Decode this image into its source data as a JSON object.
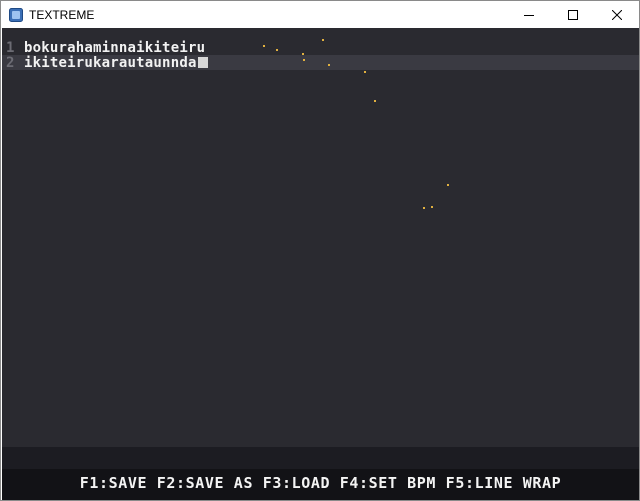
{
  "window": {
    "title": "TEXTREME",
    "icons": {
      "app": "app-icon",
      "minimize": "minimize-icon",
      "maximize": "maximize-icon",
      "close": "close-icon"
    }
  },
  "editor": {
    "lines": [
      {
        "number": "1",
        "text": "bokurahaminnaikiteiru"
      },
      {
        "number": "2",
        "text": "ikiteirukarautaunnda"
      }
    ],
    "current_line": 2,
    "particle_color": "#e0b040"
  },
  "footer": {
    "shortcuts": "F1:SAVE F2:SAVE AS F3:LOAD F4:SET BPM F5:LINE WRAP"
  },
  "colors": {
    "editor_bg": "#2a2a30",
    "current_line_bg": "#3a3a42",
    "footer_bg": "#121216"
  }
}
